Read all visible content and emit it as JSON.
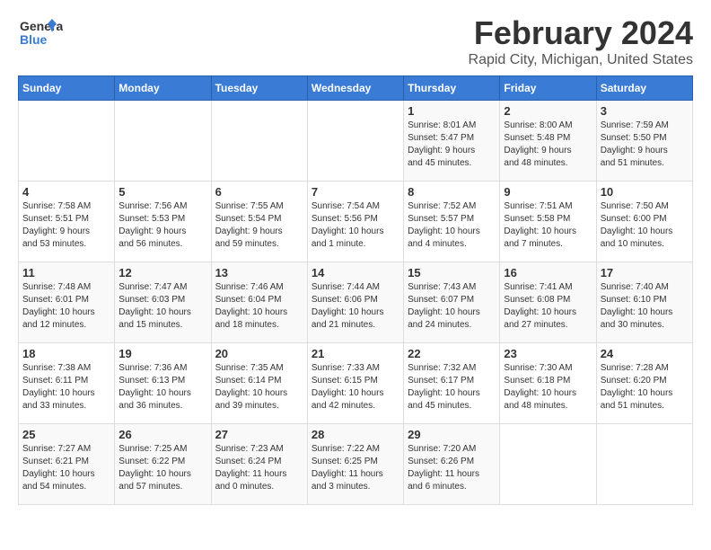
{
  "header": {
    "logo_general": "General",
    "logo_blue": "Blue",
    "title": "February 2024",
    "subtitle": "Rapid City, Michigan, United States"
  },
  "days_of_week": [
    "Sunday",
    "Monday",
    "Tuesday",
    "Wednesday",
    "Thursday",
    "Friday",
    "Saturday"
  ],
  "weeks": [
    [
      {
        "day": "",
        "info": ""
      },
      {
        "day": "",
        "info": ""
      },
      {
        "day": "",
        "info": ""
      },
      {
        "day": "",
        "info": ""
      },
      {
        "day": "1",
        "info": "Sunrise: 8:01 AM\nSunset: 5:47 PM\nDaylight: 9 hours\nand 45 minutes."
      },
      {
        "day": "2",
        "info": "Sunrise: 8:00 AM\nSunset: 5:48 PM\nDaylight: 9 hours\nand 48 minutes."
      },
      {
        "day": "3",
        "info": "Sunrise: 7:59 AM\nSunset: 5:50 PM\nDaylight: 9 hours\nand 51 minutes."
      }
    ],
    [
      {
        "day": "4",
        "info": "Sunrise: 7:58 AM\nSunset: 5:51 PM\nDaylight: 9 hours\nand 53 minutes."
      },
      {
        "day": "5",
        "info": "Sunrise: 7:56 AM\nSunset: 5:53 PM\nDaylight: 9 hours\nand 56 minutes."
      },
      {
        "day": "6",
        "info": "Sunrise: 7:55 AM\nSunset: 5:54 PM\nDaylight: 9 hours\nand 59 minutes."
      },
      {
        "day": "7",
        "info": "Sunrise: 7:54 AM\nSunset: 5:56 PM\nDaylight: 10 hours\nand 1 minute."
      },
      {
        "day": "8",
        "info": "Sunrise: 7:52 AM\nSunset: 5:57 PM\nDaylight: 10 hours\nand 4 minutes."
      },
      {
        "day": "9",
        "info": "Sunrise: 7:51 AM\nSunset: 5:58 PM\nDaylight: 10 hours\nand 7 minutes."
      },
      {
        "day": "10",
        "info": "Sunrise: 7:50 AM\nSunset: 6:00 PM\nDaylight: 10 hours\nand 10 minutes."
      }
    ],
    [
      {
        "day": "11",
        "info": "Sunrise: 7:48 AM\nSunset: 6:01 PM\nDaylight: 10 hours\nand 12 minutes."
      },
      {
        "day": "12",
        "info": "Sunrise: 7:47 AM\nSunset: 6:03 PM\nDaylight: 10 hours\nand 15 minutes."
      },
      {
        "day": "13",
        "info": "Sunrise: 7:46 AM\nSunset: 6:04 PM\nDaylight: 10 hours\nand 18 minutes."
      },
      {
        "day": "14",
        "info": "Sunrise: 7:44 AM\nSunset: 6:06 PM\nDaylight: 10 hours\nand 21 minutes."
      },
      {
        "day": "15",
        "info": "Sunrise: 7:43 AM\nSunset: 6:07 PM\nDaylight: 10 hours\nand 24 minutes."
      },
      {
        "day": "16",
        "info": "Sunrise: 7:41 AM\nSunset: 6:08 PM\nDaylight: 10 hours\nand 27 minutes."
      },
      {
        "day": "17",
        "info": "Sunrise: 7:40 AM\nSunset: 6:10 PM\nDaylight: 10 hours\nand 30 minutes."
      }
    ],
    [
      {
        "day": "18",
        "info": "Sunrise: 7:38 AM\nSunset: 6:11 PM\nDaylight: 10 hours\nand 33 minutes."
      },
      {
        "day": "19",
        "info": "Sunrise: 7:36 AM\nSunset: 6:13 PM\nDaylight: 10 hours\nand 36 minutes."
      },
      {
        "day": "20",
        "info": "Sunrise: 7:35 AM\nSunset: 6:14 PM\nDaylight: 10 hours\nand 39 minutes."
      },
      {
        "day": "21",
        "info": "Sunrise: 7:33 AM\nSunset: 6:15 PM\nDaylight: 10 hours\nand 42 minutes."
      },
      {
        "day": "22",
        "info": "Sunrise: 7:32 AM\nSunset: 6:17 PM\nDaylight: 10 hours\nand 45 minutes."
      },
      {
        "day": "23",
        "info": "Sunrise: 7:30 AM\nSunset: 6:18 PM\nDaylight: 10 hours\nand 48 minutes."
      },
      {
        "day": "24",
        "info": "Sunrise: 7:28 AM\nSunset: 6:20 PM\nDaylight: 10 hours\nand 51 minutes."
      }
    ],
    [
      {
        "day": "25",
        "info": "Sunrise: 7:27 AM\nSunset: 6:21 PM\nDaylight: 10 hours\nand 54 minutes."
      },
      {
        "day": "26",
        "info": "Sunrise: 7:25 AM\nSunset: 6:22 PM\nDaylight: 10 hours\nand 57 minutes."
      },
      {
        "day": "27",
        "info": "Sunrise: 7:23 AM\nSunset: 6:24 PM\nDaylight: 11 hours\nand 0 minutes."
      },
      {
        "day": "28",
        "info": "Sunrise: 7:22 AM\nSunset: 6:25 PM\nDaylight: 11 hours\nand 3 minutes."
      },
      {
        "day": "29",
        "info": "Sunrise: 7:20 AM\nSunset: 6:26 PM\nDaylight: 11 hours\nand 6 minutes."
      },
      {
        "day": "",
        "info": ""
      },
      {
        "day": "",
        "info": ""
      }
    ]
  ]
}
